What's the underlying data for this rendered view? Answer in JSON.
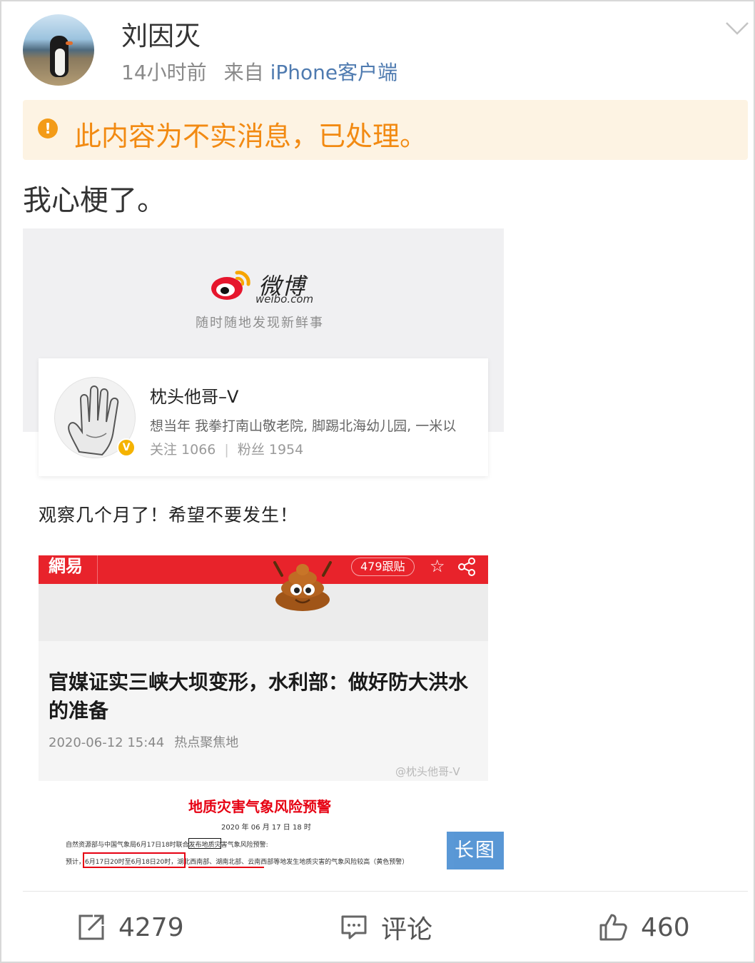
{
  "post": {
    "user_name": "刘因灭",
    "time": "14小时前",
    "from_prefix": "来自",
    "source": "iPhone客户端",
    "warning": "此内容为不实消息，已处理。",
    "text": "我心梗了。"
  },
  "embed": {
    "weibo_brand": "微博",
    "weibo_domain": "weibo.com",
    "weibo_slogan": "随时随地发现新鲜事",
    "card": {
      "name": "枕头他哥–V",
      "bio": "想当年 我拳打南山敬老院, 脚踢北海幼儿园, 一米以",
      "follow": "关注 1066",
      "fans": "粉丝 1954"
    },
    "text": "观察几个月了！希望不要发生！",
    "news": {
      "brand": "網易",
      "comment_count": "479跟贴",
      "title": "官媒证实三峡大坝变形，水利部：做好防大洪水的准备",
      "date": "2020-06-12 15:44",
      "source": "热点聚焦地",
      "watermark": "@枕头他哥-V"
    },
    "doc": {
      "title": "地质灾害气象风险预警",
      "date": "2020 年 06 月 17 日 18 时",
      "line1": "自然资源部与中国气象局6月17日18时联合发布地质灾害气象风险预警:",
      "line2": "预计，6月17日20时至6月18日20时，湖北西南部、湖南北部、云南西部等地发生地质灾害的气象风险较高（黄色预警）"
    },
    "long_image_badge": "长图"
  },
  "actions": {
    "repost_count": "4279",
    "comment_label": "评论",
    "like_count": "460"
  },
  "colors": {
    "warning_bg": "#fdf3e3",
    "warning_text": "#f28a12",
    "source_link": "#4f7bb0",
    "netease_red": "#e8232b",
    "long_badge": "#4c8fd2"
  },
  "icons": [
    "chevron-down-icon",
    "warning-icon",
    "weibo-logo-icon",
    "verified-icon",
    "star-icon",
    "share-icon",
    "poop-emoji-icon",
    "repost-icon",
    "comment-icon",
    "like-icon"
  ]
}
